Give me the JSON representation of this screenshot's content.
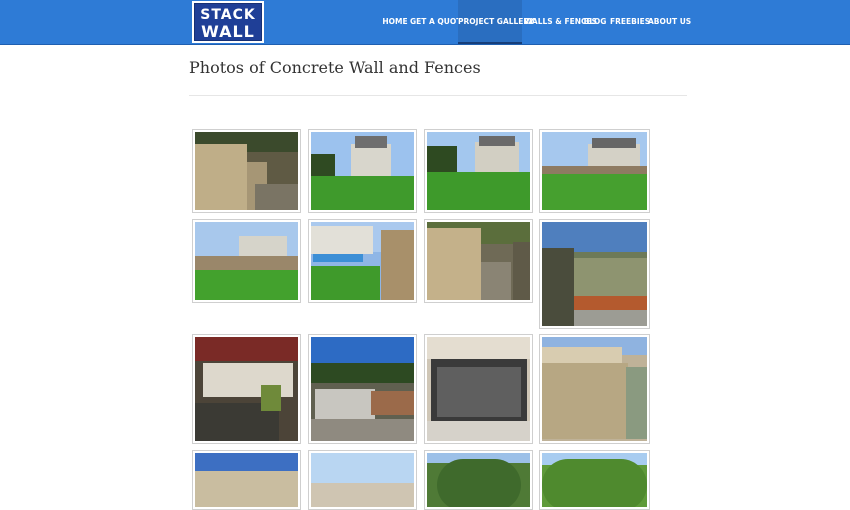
{
  "header": {
    "logo_top": "STACK",
    "logo_bottom": "WALL",
    "nav": [
      {
        "label": "HOME"
      },
      {
        "label": "GET A QUOTE"
      },
      {
        "label": "PROJECT GALLERY",
        "active": true
      },
      {
        "label": "WALLS & FENCES"
      },
      {
        "label": "BLOG"
      },
      {
        "label": "FREEBIES"
      },
      {
        "label": "ABOUT US"
      }
    ]
  },
  "main": {
    "title": "Photos of Concrete Wall and Fences"
  },
  "gallery": {
    "thumbnails": [
      {
        "scene": "retaining-wall"
      },
      {
        "scene": "house-lawn"
      },
      {
        "scene": "house-lawn"
      },
      {
        "scene": "house-fence"
      },
      {
        "scene": "house-fence"
      },
      {
        "scene": "pool-fence"
      },
      {
        "scene": "wall-path"
      },
      {
        "scene": "garden-wall"
      },
      {
        "scene": "patio-wall"
      },
      {
        "scene": "terrace-steps"
      },
      {
        "scene": "iron-gate"
      },
      {
        "scene": "lattice-wall"
      },
      {
        "scene": "lattice-top"
      },
      {
        "scene": "fence-sky"
      },
      {
        "scene": "tree"
      },
      {
        "scene": "tree"
      }
    ]
  }
}
